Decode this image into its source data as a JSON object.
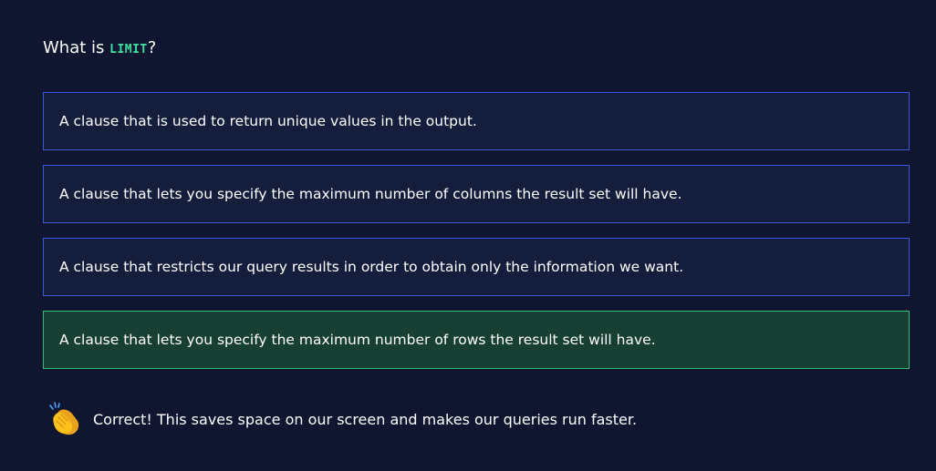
{
  "question": {
    "prefix": "What is ",
    "code": "LIMIT",
    "suffix": "?"
  },
  "options": [
    {
      "label": "A clause that is used to return unique values in the output.",
      "state": "default"
    },
    {
      "label": "A clause that lets you specify the maximum number of columns the result set will have.",
      "state": "default"
    },
    {
      "label": "A clause that restricts our query results in order to obtain only the information we want.",
      "state": "default"
    },
    {
      "label": "A clause that lets you specify the maximum number of rows the result set will have.",
      "state": "correct"
    }
  ],
  "feedback": {
    "icon": "clapping-hands-icon",
    "text": "Correct! This saves space on our screen and makes our queries run faster."
  },
  "colors": {
    "background": "#10162f",
    "option_bg": "#151d3d",
    "option_border": "#3a5bd9",
    "correct_bg": "#183f33",
    "correct_border": "#2fbf71",
    "code_accent": "#3fe0a0"
  }
}
